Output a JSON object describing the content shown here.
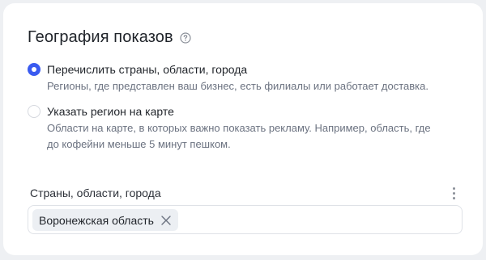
{
  "section": {
    "title": "География показов",
    "help_icon": "question-circle-icon"
  },
  "options": [
    {
      "label": "Перечислить страны, области, города",
      "description": "Регионы, где представлен ваш бизнес, есть филиалы или работает доставка.",
      "selected": true
    },
    {
      "label": "Указать регион на карте",
      "description_line1": "Области на карте, в которых важно показать рекламу. Например, область, где",
      "description_line2": "до кофейни меньше 5 минут пешком.",
      "selected": false
    }
  ],
  "regions_field": {
    "label": "Страны, области, города",
    "menu_icon": "more-vertical-icon",
    "chips": [
      {
        "label": "Воронежская область",
        "remove_icon": "close-icon"
      }
    ]
  },
  "colors": {
    "accent": "#3a5bf0",
    "background": "#eef0f3",
    "card": "#ffffff",
    "chip": "#eceff3"
  }
}
